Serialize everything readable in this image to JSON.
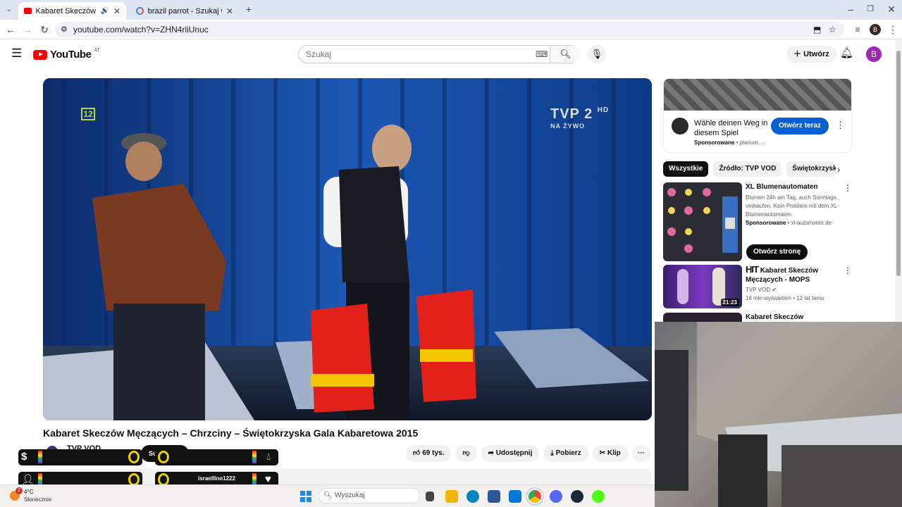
{
  "browser": {
    "tabs": [
      {
        "title": "Kabaret Skeczów Męczących",
        "active": true
      },
      {
        "title": "brazil parrot - Szukaj w Google",
        "active": false
      }
    ],
    "new_tab_label": "+",
    "url": "youtube.com/watch?v=ZHN4rliUnuc",
    "profile_initial": "B"
  },
  "youtube": {
    "logo_text": "YouTube",
    "country_code": "AT",
    "search_placeholder": "Szukaj",
    "create_label": "Utwórz",
    "avatar_initial": "B"
  },
  "video": {
    "channel_logo": "12",
    "broadcaster": "TVP 2",
    "broadcaster_hd": "HD",
    "live_label": "NA ŻYWO",
    "title": "Kabaret Skeczów Męczących – Chrzciny – Świętokrzyska Gala Kabaretowa 2015",
    "channel": "TVP VOD",
    "like_count": "69 tys.",
    "share_label": "Udostępnij",
    "download_label": "Pobierz",
    "clip_label": "Klip"
  },
  "sidebar": {
    "ad": {
      "text": "Wähle deinen Weg in diesem Spiel",
      "sponsored": "Sponsorowane",
      "domain": "plarium....",
      "cta": "Otwórz teraz"
    },
    "chips": [
      "Wszystkie",
      "Źródło: TVP VOD",
      "Świętokrzyska G"
    ],
    "items": [
      {
        "title": "XL Blumenautomaten",
        "desc": "Blumen 24h am Tag, auch Sonntags verkaufen. Kein Problem mit dem XL-Blumenautomaten.",
        "sponsored": "Sponsorowane",
        "domain": "xl-automaten.de",
        "cta": "Otwórz stronę"
      },
      {
        "title_prefix": "HIT",
        "title": "Kabaret Skeczów Męczących - MOPS",
        "channel": "TVP VOD",
        "meta": "16 mln wyświetleń • 12 lat temu",
        "duration": "21:23"
      },
      {
        "title": "Kabaret Skeczów Męczących -"
      }
    ]
  },
  "overlay": {
    "name": "israelllno1222",
    "sub_label": "Su"
  },
  "taskbar": {
    "badge": "2",
    "temp": "4°C",
    "weather": "Słonecznie",
    "search_placeholder": "Wyszukaj"
  }
}
